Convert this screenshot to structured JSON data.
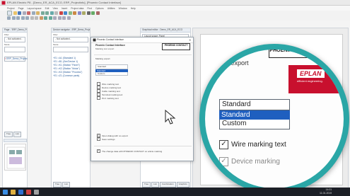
{
  "window": {
    "title": "EPLAN Electric P8 - [Demo_ER_ACA_ECO, ERP_Projectinfo], [Phoenix Contact Interface]"
  },
  "menu": [
    "Project",
    "Page",
    "Layout space",
    "Edit",
    "View",
    "Insert",
    "Project data",
    "Find",
    "Options",
    "Utilities",
    "Window",
    "Help"
  ],
  "left_panel": {
    "header": "Page - 'ERP_Demo_Project'",
    "filter_value": "- Not activated -",
    "filter_label": "Filter",
    "value_label": "Mode",
    "tree_item": "ERP_Demo_Project",
    "tab": "Tree",
    "tab2": "List"
  },
  "middle_panel": {
    "header": "Device navigator - ERP_Demo_Project",
    "filter_value": "- Not activated -",
    "filter_label": "Filter",
    "value_label": "Mode",
    "tree_items": [
      "+E1 =A1 (Standard 1)",
      "+E1 =B1 (Ger/Device 1)",
      "+E1 =K1 (Station \"Panel\")",
      "+E1 =K2 (Station \"Motor\")",
      "+E1 =K3 (Station \"Process\")",
      "+E1 =Z1 (Common parts)"
    ],
    "tab": "Tree",
    "tab2": "List"
  },
  "right_panel": {
    "header": "Graphical editor - Demo_ER_ACA_ECO",
    "header2": "Layout space: Panel",
    "tabs": [
      "Tree",
      "List",
      "Combination",
      "Graphics"
    ]
  },
  "dialog": {
    "title": "Phoenix Contact Interface",
    "subtitle": "Phoenix Contact Interface",
    "sub2": "Marking text export",
    "section": "Marking export",
    "select_value": "Standard",
    "options": [
      "Standard",
      "Custom"
    ],
    "checkboxes": [
      "Wire marking text",
      "Device marking text",
      "Cable marking text",
      "Terminal marking text",
      "PLC marking text"
    ],
    "bottom_checks": [
      "Open dialog with no export",
      "Save settings"
    ],
    "footer_check": "The change data with PHOENIX CONTACT on article marking",
    "logo": "PHOENIX CONTACT"
  },
  "magnifier": {
    "section": "Marking export",
    "select_value": "Standard",
    "options": [
      "Standard",
      "Custom"
    ],
    "checkbox1": "Wire marking text",
    "checkbox2": "Device marking",
    "logo": "PHOENIX CONTACT",
    "eplan": "EPLAN",
    "eplan_sub": "efficient engineering."
  },
  "taskbar": {
    "time": "14:01",
    "date": "11.01.2019"
  },
  "colors": {
    "accent_teal": "#2aa6a6",
    "selection_blue": "#1f5fbf",
    "eplan_red": "#c8102e"
  }
}
